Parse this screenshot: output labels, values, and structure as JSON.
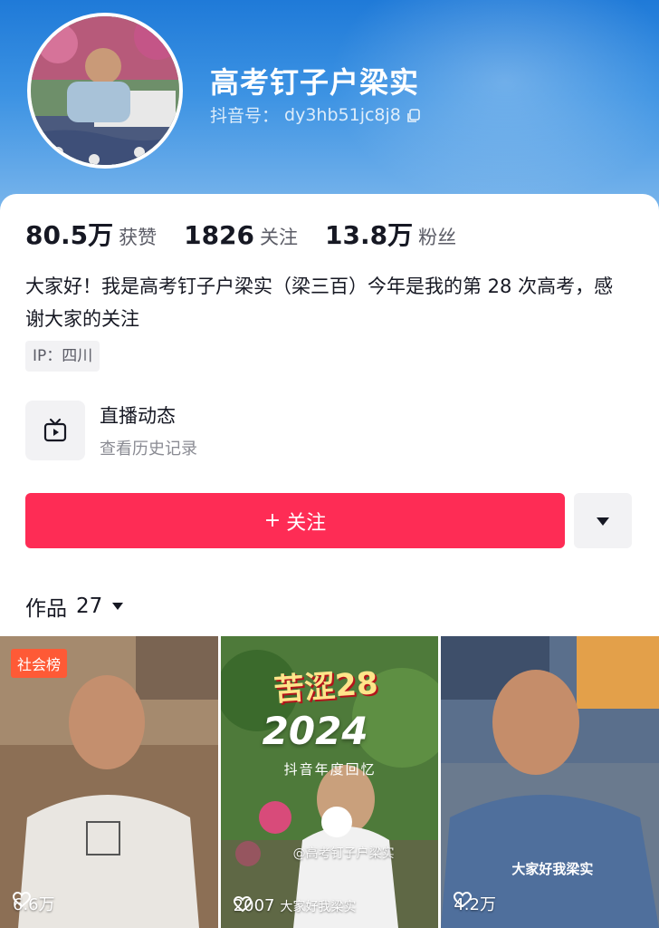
{
  "profile": {
    "username": "高考钉子户梁实",
    "id_label": "抖音号：",
    "id_value": "dy3hb51jc8j8"
  },
  "stats": {
    "likes_num": "80.5万",
    "likes_label": "获赞",
    "following_num": "1826",
    "following_label": "关注",
    "followers_num": "13.8万",
    "followers_label": "粉丝"
  },
  "bio": {
    "text": "大家好！我是高考钉子户梁实（梁三百）今年是我的第 28 次高考，感谢大家的关注",
    "ip": "IP：四川"
  },
  "live": {
    "title": "直播动态",
    "subtitle": "查看历史记录"
  },
  "actions": {
    "follow_plus": "+",
    "follow_label": "关注"
  },
  "works": {
    "label": "作品",
    "count": "27"
  },
  "videos": [
    {
      "badge": "社会榜",
      "likes": "6.6万"
    },
    {
      "title_text": "苦涩28",
      "year_text": "2024",
      "sub_text": "抖音年度回忆",
      "watermark": "@高考钉子户梁实",
      "likes": "2007",
      "caption": "大家好我梁实"
    },
    {
      "caption": "大家好我梁实",
      "likes": "4.2万"
    }
  ],
  "colors": {
    "accent": "#fe2c55",
    "header_blue": "#1f7ad8",
    "badge": "#fe5a36"
  },
  "icons": {
    "copy": "copy-icon",
    "tv": "tv-icon",
    "dropdown": "triangle-down-icon",
    "heart": "heart-icon"
  }
}
